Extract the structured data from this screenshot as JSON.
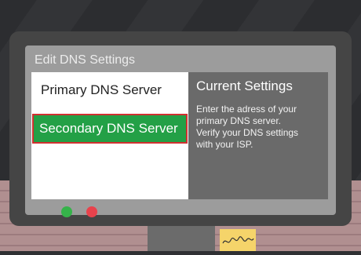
{
  "window": {
    "title": "Edit DNS Settings"
  },
  "menu": {
    "items": [
      {
        "label": "Primary DNS Server"
      },
      {
        "label": "Secondary DNS Server",
        "selected": true
      }
    ]
  },
  "info_panel": {
    "heading": "Current Settings",
    "lines": [
      "Enter the adress of your",
      "primary DNS server.",
      "Verify your DNS settings",
      "with your ISP."
    ]
  },
  "controls": {
    "buttons": [
      {
        "name": "green-button",
        "color": "#35b34a"
      },
      {
        "name": "red-button",
        "color": "#e8424c"
      }
    ]
  },
  "colors": {
    "selected_item": "#23a046",
    "selection_border": "#d03030",
    "info_panel_bg": "#6a6a6a"
  }
}
